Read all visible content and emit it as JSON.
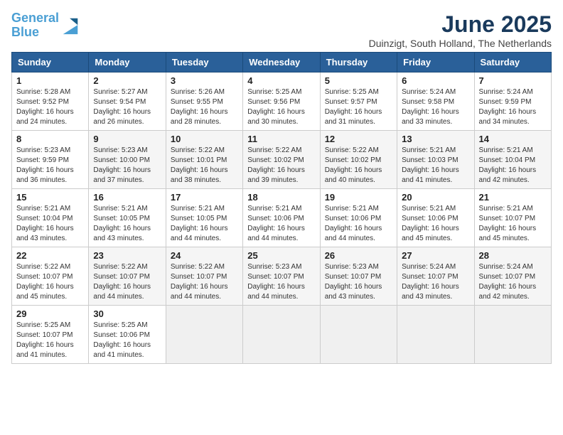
{
  "logo": {
    "line1": "General",
    "line2": "Blue"
  },
  "title": "June 2025",
  "location": "Duinzigt, South Holland, The Netherlands",
  "weekdays": [
    "Sunday",
    "Monday",
    "Tuesday",
    "Wednesday",
    "Thursday",
    "Friday",
    "Saturday"
  ],
  "weeks": [
    [
      {
        "day": "1",
        "sunrise": "5:28 AM",
        "sunset": "9:52 PM",
        "daylight": "16 hours and 24 minutes."
      },
      {
        "day": "2",
        "sunrise": "5:27 AM",
        "sunset": "9:54 PM",
        "daylight": "16 hours and 26 minutes."
      },
      {
        "day": "3",
        "sunrise": "5:26 AM",
        "sunset": "9:55 PM",
        "daylight": "16 hours and 28 minutes."
      },
      {
        "day": "4",
        "sunrise": "5:25 AM",
        "sunset": "9:56 PM",
        "daylight": "16 hours and 30 minutes."
      },
      {
        "day": "5",
        "sunrise": "5:25 AM",
        "sunset": "9:57 PM",
        "daylight": "16 hours and 31 minutes."
      },
      {
        "day": "6",
        "sunrise": "5:24 AM",
        "sunset": "9:58 PM",
        "daylight": "16 hours and 33 minutes."
      },
      {
        "day": "7",
        "sunrise": "5:24 AM",
        "sunset": "9:59 PM",
        "daylight": "16 hours and 34 minutes."
      }
    ],
    [
      {
        "day": "8",
        "sunrise": "5:23 AM",
        "sunset": "9:59 PM",
        "daylight": "16 hours and 36 minutes."
      },
      {
        "day": "9",
        "sunrise": "5:23 AM",
        "sunset": "10:00 PM",
        "daylight": "16 hours and 37 minutes."
      },
      {
        "day": "10",
        "sunrise": "5:22 AM",
        "sunset": "10:01 PM",
        "daylight": "16 hours and 38 minutes."
      },
      {
        "day": "11",
        "sunrise": "5:22 AM",
        "sunset": "10:02 PM",
        "daylight": "16 hours and 39 minutes."
      },
      {
        "day": "12",
        "sunrise": "5:22 AM",
        "sunset": "10:02 PM",
        "daylight": "16 hours and 40 minutes."
      },
      {
        "day": "13",
        "sunrise": "5:21 AM",
        "sunset": "10:03 PM",
        "daylight": "16 hours and 41 minutes."
      },
      {
        "day": "14",
        "sunrise": "5:21 AM",
        "sunset": "10:04 PM",
        "daylight": "16 hours and 42 minutes."
      }
    ],
    [
      {
        "day": "15",
        "sunrise": "5:21 AM",
        "sunset": "10:04 PM",
        "daylight": "16 hours and 43 minutes."
      },
      {
        "day": "16",
        "sunrise": "5:21 AM",
        "sunset": "10:05 PM",
        "daylight": "16 hours and 43 minutes."
      },
      {
        "day": "17",
        "sunrise": "5:21 AM",
        "sunset": "10:05 PM",
        "daylight": "16 hours and 44 minutes."
      },
      {
        "day": "18",
        "sunrise": "5:21 AM",
        "sunset": "10:06 PM",
        "daylight": "16 hours and 44 minutes."
      },
      {
        "day": "19",
        "sunrise": "5:21 AM",
        "sunset": "10:06 PM",
        "daylight": "16 hours and 44 minutes."
      },
      {
        "day": "20",
        "sunrise": "5:21 AM",
        "sunset": "10:06 PM",
        "daylight": "16 hours and 45 minutes."
      },
      {
        "day": "21",
        "sunrise": "5:21 AM",
        "sunset": "10:07 PM",
        "daylight": "16 hours and 45 minutes."
      }
    ],
    [
      {
        "day": "22",
        "sunrise": "5:22 AM",
        "sunset": "10:07 PM",
        "daylight": "16 hours and 45 minutes."
      },
      {
        "day": "23",
        "sunrise": "5:22 AM",
        "sunset": "10:07 PM",
        "daylight": "16 hours and 44 minutes."
      },
      {
        "day": "24",
        "sunrise": "5:22 AM",
        "sunset": "10:07 PM",
        "daylight": "16 hours and 44 minutes."
      },
      {
        "day": "25",
        "sunrise": "5:23 AM",
        "sunset": "10:07 PM",
        "daylight": "16 hours and 44 minutes."
      },
      {
        "day": "26",
        "sunrise": "5:23 AM",
        "sunset": "10:07 PM",
        "daylight": "16 hours and 43 minutes."
      },
      {
        "day": "27",
        "sunrise": "5:24 AM",
        "sunset": "10:07 PM",
        "daylight": "16 hours and 43 minutes."
      },
      {
        "day": "28",
        "sunrise": "5:24 AM",
        "sunset": "10:07 PM",
        "daylight": "16 hours and 42 minutes."
      }
    ],
    [
      {
        "day": "29",
        "sunrise": "5:25 AM",
        "sunset": "10:07 PM",
        "daylight": "16 hours and 41 minutes."
      },
      {
        "day": "30",
        "sunrise": "5:25 AM",
        "sunset": "10:06 PM",
        "daylight": "16 hours and 41 minutes."
      },
      null,
      null,
      null,
      null,
      null
    ]
  ],
  "labels": {
    "sunrise": "Sunrise:",
    "sunset": "Sunset:",
    "daylight": "Daylight:"
  }
}
